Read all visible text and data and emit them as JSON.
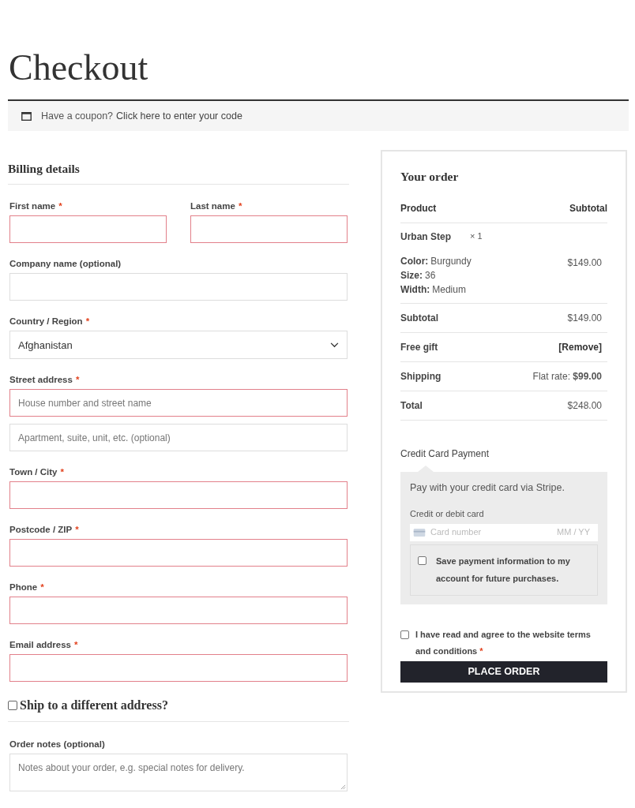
{
  "page_title": "Checkout",
  "coupon_notice": {
    "text": "Have a coupon?",
    "link": "Click here to enter your code"
  },
  "billing": {
    "title": "Billing details",
    "rows": [
      [
        {
          "label": "First name",
          "mark": "*",
          "kind": "input",
          "invalid": true
        },
        {
          "label": "Last name",
          "mark": "*",
          "kind": "input",
          "invalid": true
        }
      ],
      [
        {
          "label": "Company name (optional)",
          "kind": "input",
          "invalid": false
        }
      ],
      [
        {
          "label": "Country / Region",
          "mark": "*",
          "kind": "select",
          "value": "Afghanistan",
          "invalid": false
        }
      ],
      [
        {
          "label": "Street address",
          "mark": "*",
          "kind": "input",
          "placeholder": "House number and street name",
          "invalid": true
        }
      ],
      [
        {
          "kind": "input",
          "placeholder": "Apartment, suite, unit, etc. (optional)",
          "invalid": false
        }
      ],
      [
        {
          "label": "Town / City",
          "mark": "*",
          "kind": "input",
          "invalid": true
        }
      ],
      [
        {
          "label": "Postcode / ZIP",
          "mark": "*",
          "kind": "input",
          "invalid": true
        }
      ],
      [
        {
          "label": "Phone",
          "mark": "*",
          "kind": "input",
          "invalid": true
        }
      ],
      [
        {
          "label": "Email address",
          "mark": "*",
          "kind": "input",
          "invalid": true
        }
      ]
    ]
  },
  "shipping_toggle": {
    "label": "Ship to a different address?",
    "checked": false
  },
  "order_notes": {
    "label": "Order notes (optional)",
    "kind": "textarea",
    "placeholder": "Notes about your order, e.g. special notes for delivery.",
    "invalid": false
  },
  "order": {
    "title": "Your order",
    "columns": [
      "Product",
      "Subtotal"
    ],
    "items": [
      {
        "name": "Urban Step",
        "quantity": "× 1",
        "meta": [
          {
            "key": "Color:",
            "value": "Burgundy"
          },
          {
            "key": "Size:",
            "value": "36"
          },
          {
            "key": "Width:",
            "value": "Medium"
          }
        ],
        "subtotal": "$149.00"
      }
    ],
    "totals": [
      {
        "label": "Subtotal",
        "value": "$149.00",
        "kind": "text"
      },
      {
        "label": "Free gift",
        "value": "[Remove]",
        "kind": "link"
      },
      {
        "label": "Shipping",
        "value": "Flat rate: **$99.00**",
        "kind": "text"
      },
      {
        "label": "Total",
        "value": "$248.00",
        "kind": "text"
      }
    ]
  },
  "payment": {
    "method": "Credit Card Payment",
    "description": "Pay with your credit card via Stripe.",
    "card_label": "Credit or debit card",
    "card_placeholder": "Card number",
    "expiry_placeholder": "MM / YY",
    "save_info": {
      "label": "Save payment information to my account for future purchases.",
      "checked": false
    }
  },
  "terms": {
    "label": "I have read and agree to the website terms and conditions",
    "mark": "*",
    "checked": false
  },
  "place_order": "PLACE ORDER"
}
